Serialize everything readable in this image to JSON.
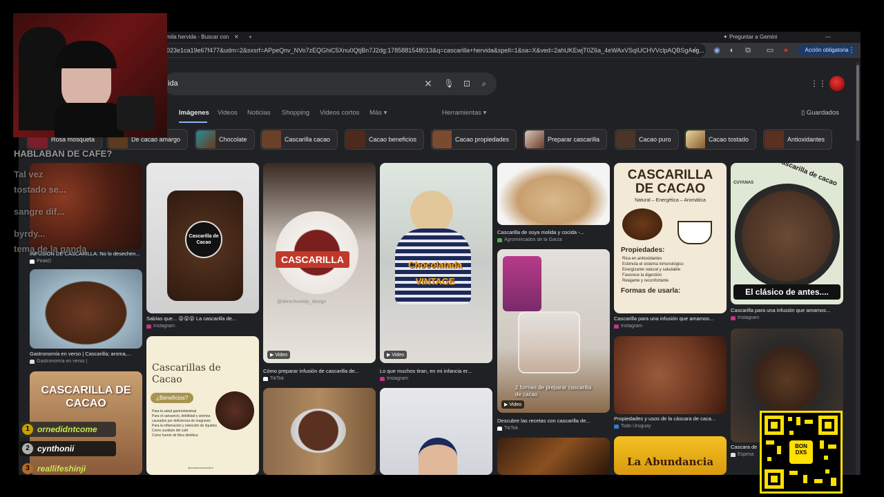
{
  "browser": {
    "tab_title": "mila hervida - Buscar con",
    "ask_label": "Preguntar a Gemini",
    "url": "023e1ca19e67f477&udm=2&sxsrf=APpeQnv_NVo7zEQGhiC5Xnu0QtjBn7J2dg:1785881548013&q=cascarilla+hervida&spell=1&sa=X&ved=2ahUKEwjT0Z6a_4eWAxVSqIUCHVVclpAQBSgAeg...",
    "action_button": "Acción obligatoria"
  },
  "search": {
    "query": "ida"
  },
  "nav": {
    "tabs": [
      "Imágenes",
      "Videos",
      "Noticias",
      "Shopping",
      "Videos cortos",
      "Más"
    ],
    "tools": "Herramientas",
    "saved": "Guardados"
  },
  "chips": [
    "Rosa mosqueta",
    "De cacao amargo",
    "Chocolate",
    "Cascarilla cacao",
    "Cacao beneficios",
    "Cacao propiedades",
    "Preparar cascarilla",
    "Cacao puro",
    "Cacao tostado",
    "Antioxidantes"
  ],
  "results": {
    "r1": {
      "caption": "INFUSIÓN DE CASCARILLA: No lo desechen...",
      "source": "PeakD"
    },
    "r2": {
      "caption": "Gastronomía en verso | Cascarilla; aroma,...",
      "source": "Gastronomía en verso |"
    },
    "r3": {
      "overlay_title": "CASCARILLA DE CACAO"
    },
    "r4": {
      "caption": "Sabías que... 😮😮😮 La cascarilla de...",
      "source": "Instagram",
      "bag_label": "Cascarilla de Cacao"
    },
    "r5": {
      "title": "Cascarillas de Cacao",
      "subtitle": "¿Beneficios?",
      "bullets": [
        "Para la salud gastrointestinal",
        "Para el cansancio, debilidad y anemia causados por deficiencia de magnesio",
        "Para la inflamación y retención de líquidos",
        "Como sustituto del café",
        "Como fuente de fibra dietética"
      ],
      "footer": "@madrecacaoonline"
    },
    "r6": {
      "overlay": "CASCARILLA",
      "watermark": "@derechoviejo_design",
      "badge": "Video",
      "caption": "Cómo preparar infusión de cascarilla de...",
      "source": "TikTok"
    },
    "r7": {
      "overlay1": "Chocolatada",
      "overlay2": "VINTAGE",
      "badge": "Video",
      "caption": "Lo que muchos tiran, en mi infancia er...",
      "source": "Instagram"
    },
    "r8": {
      "caption": "Cascarilla de soya molida y cocida -...",
      "source": "Agromercados de la Garza"
    },
    "r9": {
      "overlay": "2 formas de preparar cascarilla de cacao",
      "badge": "Video",
      "caption": "Descubre las recetas con cascarilla de...",
      "source": "TikTok"
    },
    "r10": {
      "title1": "CASCARILLA",
      "title2": "DE CACAO",
      "tagline": "Natural – Energética – Aromática",
      "props_title": "Propiedades:",
      "props": [
        "Rica en antioxidantes",
        "Estimula el sistema inmunológico",
        "Energizante natural y saludable",
        "Favorece la digestión",
        "Relajante y reconfortante"
      ],
      "uses_title": "Formas de usarla:",
      "caption": "Cascarilla para una infusión que amamos...",
      "source": "Instagram"
    },
    "r11": {
      "caption": "Propiedades y usos de la cáscara de caca...",
      "source": "Todo Uruguay"
    },
    "r12": {
      "label": "La Abundancia"
    },
    "r13": {
      "brand": "CUYANAS",
      "curved": "Cascarilla de cacao",
      "banner": "El clásico de antes....",
      "caption": "Cascarilla para una infusión que amamos...",
      "source": "Instagram"
    },
    "r14": {
      "caption": "Cascara de",
      "source": "Espesa"
    }
  },
  "overlay": {
    "chat": [
      "HABLABAN DE CAFE?",
      "Tal vez",
      "tostado se...",
      "sangre dif...",
      "byrdy...",
      "tema de la ganda"
    ],
    "leaderboard": [
      {
        "rank": "1",
        "name": "ornedidntcome"
      },
      {
        "rank": "2",
        "name": "cynthonii"
      },
      {
        "rank": "3",
        "name": "reallifeshinji"
      }
    ],
    "qr_label": "BON DXS"
  },
  "colors": {
    "accent": "#8ab4f8",
    "page_bg": "#202124",
    "chip_bg": "#2a2a2d",
    "action": "#1b3a69"
  }
}
